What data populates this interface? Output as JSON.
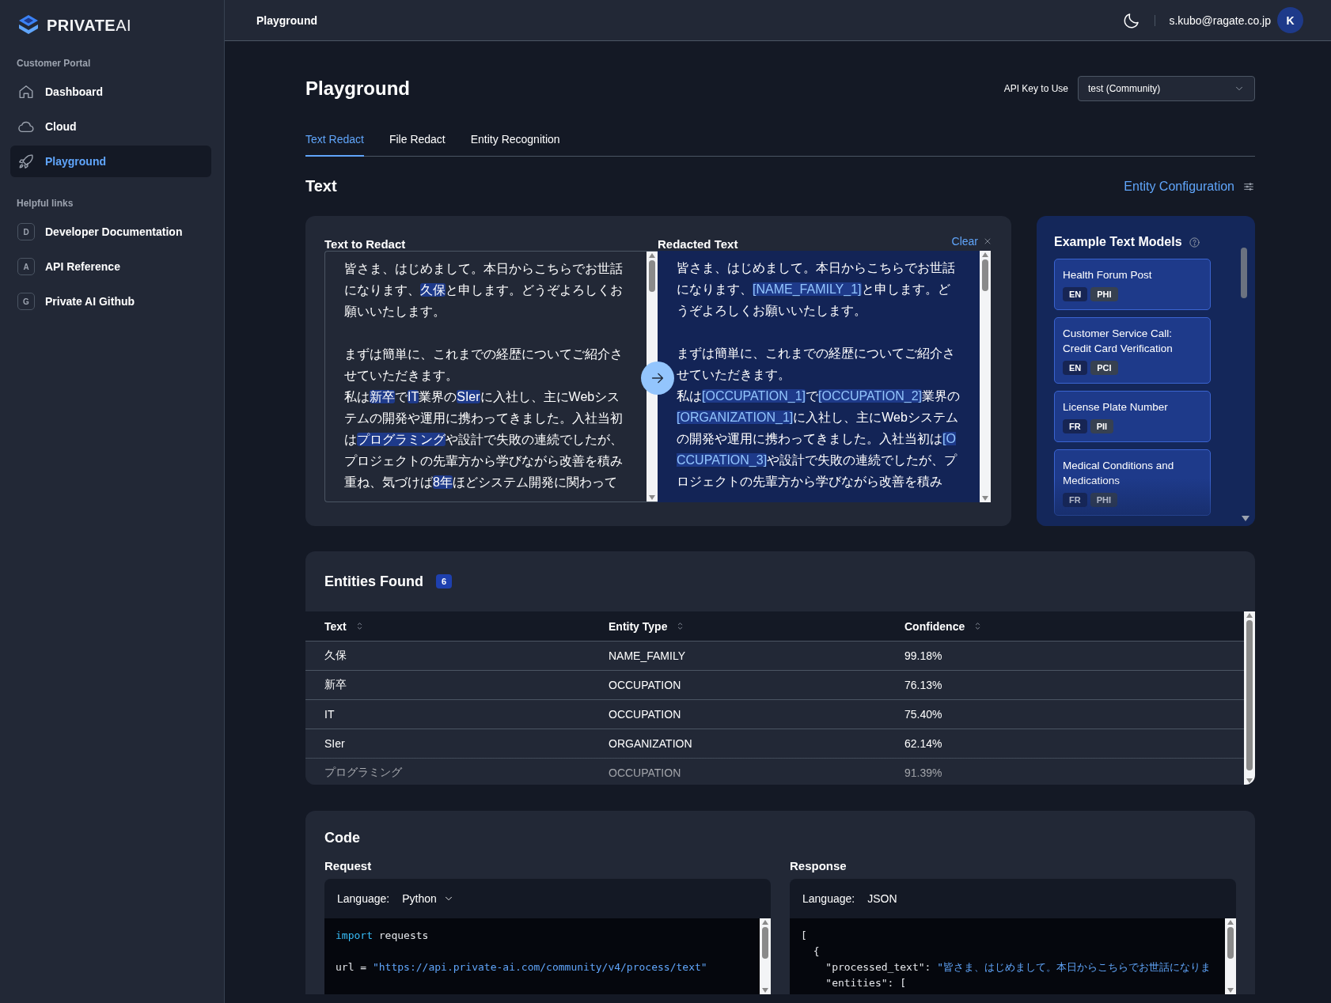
{
  "sidebar": {
    "logo": "**PRIVATE**AI",
    "sections": [
      {
        "heading": "Customer Portal",
        "kind": "pages",
        "items": [
          {
            "label": "Dashboard",
            "selected": false
          },
          {
            "label": "Cloud",
            "selected": false
          },
          {
            "label": "Playground",
            "selected": true
          }
        ]
      },
      {
        "heading": "Helpful links",
        "kind": "links",
        "items": [
          {
            "badge": "D",
            "label": "Developer Documentation",
            "selected": false
          },
          {
            "badge": "A",
            "label": "API Reference",
            "selected": false
          },
          {
            "badge": "G",
            "label": "Private AI Github",
            "selected": false
          }
        ]
      }
    ]
  },
  "top_bar": {
    "breadcrumb": "Playground",
    "user_email": "s.kubo@ragate.co.jp",
    "avatar": "K"
  },
  "page": {
    "title": "Playground",
    "api_key_label": "API Key to Use",
    "api_key_value": "test (Community)"
  },
  "tabs": [
    {
      "label": "Text Redact",
      "selected": true
    },
    {
      "label": "File Redact",
      "selected": false
    },
    {
      "label": "Entity Recognition",
      "selected": false
    }
  ],
  "text_section": {
    "title": "Text",
    "config_link": "Entity Configuration"
  },
  "input_panel": {
    "label": "Text to Redact",
    "paragraphs": [
      [
        [
          {
            "text": "皆さま、はじめまして。本日からこちらでお世話になります、",
            "highlighted": false
          },
          {
            "text": "久保",
            "highlighted": true
          },
          {
            "text": "と申します。どうぞよろしくお願いいたします。",
            "highlighted": false
          }
        ]
      ],
      [
        [
          {
            "text": "まずは簡単に、これまでの経歴についてご紹介させていただきます。",
            "highlighted": false
          }
        ],
        [
          {
            "text": "私は",
            "highlighted": false
          },
          {
            "text": "新卒",
            "highlighted": true
          },
          {
            "text": "で",
            "highlighted": false
          },
          {
            "text": "IT",
            "highlighted": true
          },
          {
            "text": "業界の",
            "highlighted": false
          },
          {
            "text": "SIer",
            "highlighted": true
          },
          {
            "text": "に入社し、主にWebシステムの開発や運用に携わってきました。入社当初は",
            "highlighted": false
          },
          {
            "text": "プログラミング",
            "highlighted": true
          },
          {
            "text": "や設計で失敗の連続でしたが、プロジェクトの先輩方から学びながら改善を積み重ね、気づけば",
            "highlighted": false
          },
          {
            "text": "8年",
            "highlighted": true
          },
          {
            "text": "ほどシステム開発に関わって",
            "highlighted": false
          }
        ]
      ]
    ]
  },
  "output_panel": {
    "label": "Redacted Text",
    "clear": "Clear",
    "paragraphs": [
      [
        [
          {
            "text": "皆さま、はじめまして。本日からこちらでお世話になります、",
            "highlighted": false
          },
          {
            "text": "[NAME_FAMILY_1]",
            "highlighted": true
          },
          {
            "text": "と申します。どうぞよろしくお願いいたします。",
            "highlighted": false
          }
        ]
      ],
      [
        [
          {
            "text": "まずは簡単に、これまでの経歴についてご紹介させていただきます。",
            "highlighted": false
          }
        ],
        [
          {
            "text": "私は",
            "highlighted": false
          },
          {
            "text": "[OCCUPATION_1]",
            "highlighted": true
          },
          {
            "text": "で",
            "highlighted": false
          },
          {
            "text": "[OCCUPATION_2]",
            "highlighted": true
          },
          {
            "text": "業界の",
            "highlighted": false
          },
          {
            "text": "[ORGANIZATION_1]",
            "highlighted": true
          },
          {
            "text": "に入社し、主にWebシステムの開発や運用に携わってきました。入社当初は",
            "highlighted": false
          },
          {
            "text": "[OCCUPATION_3]",
            "highlighted": true
          },
          {
            "text": "や設計で失敗の連続でしたが、プロジェクトの先輩方から学びながら改善を積み",
            "highlighted": false
          }
        ]
      ]
    ]
  },
  "examples": {
    "title": "Example Text Models",
    "models": [
      {
        "title": "Health Forum Post",
        "tags": [
          {
            "label": "EN",
            "kind": "language"
          },
          {
            "label": "PHI",
            "kind": "category"
          }
        ]
      },
      {
        "title": "Customer Service Call: Credit Card Verification",
        "tags": [
          {
            "label": "EN",
            "kind": "language"
          },
          {
            "label": "PCI",
            "kind": "category"
          }
        ]
      },
      {
        "title": "License Plate Number",
        "tags": [
          {
            "label": "FR",
            "kind": "language"
          },
          {
            "label": "PII",
            "kind": "category"
          }
        ]
      },
      {
        "title": "Medical Conditions and Medications",
        "tags": [
          {
            "label": "FR",
            "kind": "language"
          },
          {
            "label": "PHI",
            "kind": "category"
          }
        ]
      }
    ]
  },
  "entities": {
    "title": "Entities Found",
    "count": "6",
    "columns": [
      "Text",
      "Entity Type",
      "Confidence"
    ],
    "rows": [
      [
        "久保",
        "NAME_FAMILY",
        "99.18%"
      ],
      [
        "新卒",
        "OCCUPATION",
        "76.13%"
      ],
      [
        "IT",
        "OCCUPATION",
        "75.40%"
      ],
      [
        "SIer",
        "ORGANIZATION",
        "62.14%"
      ],
      [
        "プログラミング",
        "OCCUPATION",
        "91.39%"
      ]
    ]
  },
  "code": {
    "title": "Code",
    "panels": [
      {
        "title": "Request",
        "language_label": "Language:",
        "language": "Python",
        "kind": "select",
        "blocks": [
          [
            [
              {
                "text": "import",
                "kind": "keyword"
              },
              {
                "text": " requests",
                "kind": "plain"
              }
            ]
          ],
          [
            [
              {
                "text": "url = ",
                "kind": "plain"
              },
              {
                "text": "\"https://api.private-ai.com/community/v4/process/text\"",
                "kind": "string"
              }
            ]
          ]
        ]
      },
      {
        "title": "Response",
        "language_label": "Language:",
        "language": "JSON",
        "kind": "fixed",
        "blocks": [
          [
            [
              {
                "text": "[",
                "kind": "plain"
              }
            ],
            [
              {
                "text": "  {",
                "kind": "plain"
              }
            ],
            [
              {
                "text": "    \"processed_text\": ",
                "kind": "plain"
              },
              {
                "text": "\"皆さま、はじめまして。本日からこちらでお世話になりま",
                "kind": "string"
              }
            ],
            [
              {
                "text": "    \"entities\": [",
                "kind": "plain"
              }
            ]
          ]
        ]
      }
    ]
  }
}
